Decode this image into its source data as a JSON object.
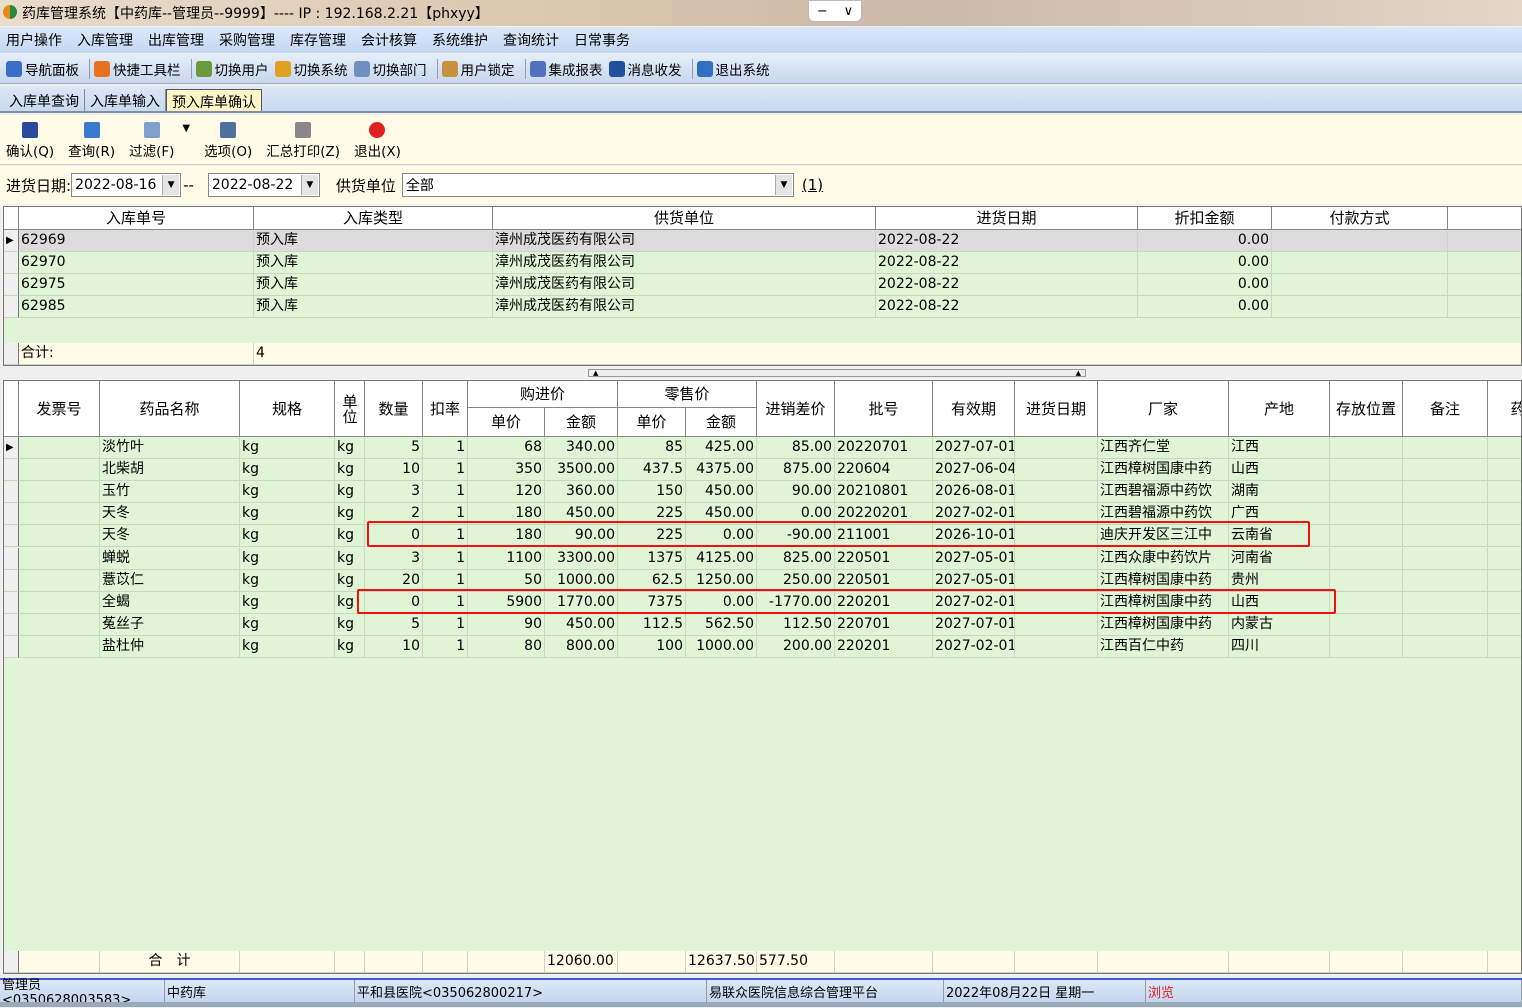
{
  "window": {
    "title": "药库管理系统【中药库--管理员--9999】---- IP : 192.168.2.21【phxyy】",
    "min": "−",
    "chev": "∨"
  },
  "menu": [
    "用户操作",
    "入库管理",
    "出库管理",
    "采购管理",
    "库存管理",
    "会计核算",
    "系统维护",
    "查询统计",
    "日常事务"
  ],
  "toolbar": [
    {
      "label": "导航面板",
      "icon": "navigation-panel-icon",
      "color": "#3a6fc8"
    },
    {
      "label": "快捷工具栏",
      "icon": "shortcut-toolbar-icon",
      "color": "#e87020"
    },
    {
      "label": "切换用户",
      "icon": "switch-user-icon",
      "color": "#6a9a3a"
    },
    {
      "label": "切换系统",
      "icon": "switch-system-icon",
      "color": "#e0a020"
    },
    {
      "label": "切换部门",
      "icon": "switch-department-icon",
      "color": "#7090c0"
    },
    {
      "label": "用户锁定",
      "icon": "user-lock-icon",
      "color": "#c89040"
    },
    {
      "label": "集成报表",
      "icon": "report-icon",
      "color": "#5070c0"
    },
    {
      "label": "消息收发",
      "icon": "info-icon",
      "color": "#2050a0"
    },
    {
      "label": "退出系统",
      "icon": "exit-system-icon",
      "color": "#3070c0"
    }
  ],
  "tabs": [
    {
      "label": "入库单查询",
      "active": false
    },
    {
      "label": "入库单输入",
      "active": false
    },
    {
      "label": "预入库单确认",
      "active": true
    }
  ],
  "actions": [
    {
      "label": "确认(Q)",
      "icon": "checkbox-icon",
      "color": "#2a4aa0"
    },
    {
      "label": "查询(R)",
      "icon": "refresh-icon",
      "color": "#3a7ad0"
    },
    {
      "label": "过滤(F)",
      "icon": "filter-icon",
      "color": "#80a0d0"
    },
    {
      "label": "选项(O)",
      "icon": "options-icon",
      "color": "#5070a0"
    },
    {
      "label": "汇总打印(Z)",
      "icon": "printer-icon",
      "color": "#888888"
    },
    {
      "label": "退出(X)",
      "icon": "power-icon",
      "color": "#e02020"
    }
  ],
  "filters": {
    "date_label": "进货日期:",
    "date_from": "2022-08-16",
    "dash": "--",
    "date_to": "2022-08-22",
    "supplier_label": "供货单位",
    "supplier": "全部",
    "count": "(1)"
  },
  "orders": {
    "columns": [
      "入库单号",
      "入库类型",
      "供货单位",
      "进货日期",
      "折扣金额",
      "付款方式"
    ],
    "rows": [
      [
        "62969",
        "预入库",
        "漳州成茂医药有限公司",
        "2022-08-22",
        "0.00",
        ""
      ],
      [
        "62970",
        "预入库",
        "漳州成茂医药有限公司",
        "2022-08-22",
        "0.00",
        ""
      ],
      [
        "62975",
        "预入库",
        "漳州成茂医药有限公司",
        "2022-08-22",
        "0.00",
        ""
      ],
      [
        "62985",
        "预入库",
        "漳州成茂医药有限公司",
        "2022-08-22",
        "0.00",
        ""
      ]
    ],
    "total_label": "合计:",
    "total_count": "4"
  },
  "details": {
    "columns": [
      "发票号",
      "药品名称",
      "规格",
      "单位",
      "数量",
      "扣率",
      "单价",
      "金额",
      "单价",
      "金额",
      "进销差价",
      "批号",
      "有效期",
      "进货日期",
      "厂家",
      "产地",
      "存放位置",
      "备注",
      "药品"
    ],
    "groups": {
      "purchase": "购进价",
      "retail": "零售价"
    },
    "rows": [
      [
        "",
        "淡竹叶",
        "kg",
        "kg",
        "5",
        "1",
        "68",
        "340.00",
        "85",
        "425.00",
        "85.00",
        "20220701",
        "2027-07-01",
        "",
        "江西齐仁堂",
        "江西",
        "",
        "",
        ""
      ],
      [
        "",
        "北柴胡",
        "kg",
        "kg",
        "10",
        "1",
        "350",
        "3500.00",
        "437.5",
        "4375.00",
        "875.00",
        "220604",
        "2027-06-04",
        "",
        "江西樟树国康中药",
        "山西",
        "",
        "",
        ""
      ],
      [
        "",
        "玉竹",
        "kg",
        "kg",
        "3",
        "1",
        "120",
        "360.00",
        "150",
        "450.00",
        "90.00",
        "20210801",
        "2026-08-01",
        "",
        "江西碧福源中药饮",
        "湖南",
        "",
        "",
        ""
      ],
      [
        "",
        "天冬",
        "kg",
        "kg",
        "2",
        "1",
        "180",
        "450.00",
        "225",
        "450.00",
        "0.00",
        "20220201",
        "2027-02-01",
        "",
        "江西碧福源中药饮",
        "广西",
        "",
        "",
        ""
      ],
      [
        "",
        "天冬",
        "kg",
        "kg",
        "0",
        "1",
        "180",
        "90.00",
        "225",
        "0.00",
        "-90.00",
        "211001",
        "2026-10-01",
        "",
        "迪庆开发区三江中",
        "云南省",
        "",
        "",
        ""
      ],
      [
        "",
        "蝉蜕",
        "kg",
        "kg",
        "3",
        "1",
        "1100",
        "3300.00",
        "1375",
        "4125.00",
        "825.00",
        "220501",
        "2027-05-01",
        "",
        "江西众康中药饮片",
        "河南省",
        "",
        "",
        ""
      ],
      [
        "",
        "薏苡仁",
        "kg",
        "kg",
        "20",
        "1",
        "50",
        "1000.00",
        "62.5",
        "1250.00",
        "250.00",
        "220501",
        "2027-05-01",
        "",
        "江西樟树国康中药",
        "贵州",
        "",
        "",
        ""
      ],
      [
        "",
        "全蝎",
        "kg",
        "kg",
        "0",
        "1",
        "5900",
        "1770.00",
        "7375",
        "0.00",
        "-1770.00",
        "220201",
        "2027-02-01",
        "",
        "江西樟树国康中药",
        "山西",
        "",
        "",
        ""
      ],
      [
        "",
        "菟丝子",
        "kg",
        "kg",
        "5",
        "1",
        "90",
        "450.00",
        "112.5",
        "562.50",
        "112.50",
        "220701",
        "2027-07-01",
        "",
        "江西樟树国康中药",
        "内蒙古",
        "",
        "",
        ""
      ],
      [
        "",
        "盐杜仲",
        "kg",
        "kg",
        "10",
        "1",
        "80",
        "800.00",
        "100",
        "1000.00",
        "200.00",
        "220201",
        "2027-02-01",
        "",
        "江西百仁中药",
        "四川",
        "",
        "",
        ""
      ]
    ],
    "total_label": "合　计",
    "total_purchase": "12060.00",
    "total_retail": "12637.50",
    "total_diff": "577.50",
    "highlight_color": "#f01010"
  },
  "status": [
    "管理员<0350628003583>",
    "中药库",
    "平和县医院<035062800217>",
    "易联众医院信息综合管理平台",
    "2022年08月22日 星期一",
    "浏览"
  ]
}
